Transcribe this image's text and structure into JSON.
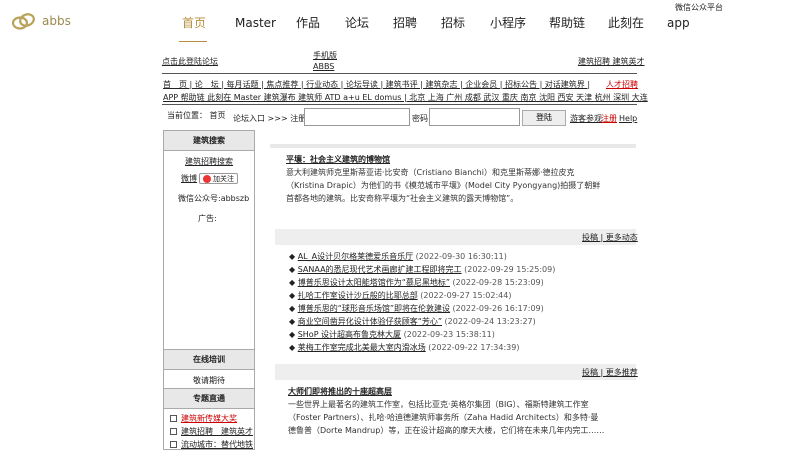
{
  "header": {
    "logo_text": "abbs",
    "wechat_platform": "微信公众平台",
    "nav": [
      {
        "label": "首页",
        "active": true
      },
      {
        "label": "Master"
      },
      {
        "label": "作品"
      },
      {
        "label": "论坛"
      },
      {
        "label": "招聘"
      },
      {
        "label": "招标"
      },
      {
        "label": "小程序"
      },
      {
        "label": "帮助链"
      },
      {
        "label": "此刻在"
      },
      {
        "label": "app"
      }
    ],
    "accent_color": "#b98d3e"
  },
  "subheader": {
    "login_hint": "点击此登陆论坛",
    "mobile_line1": "手机版",
    "mobile_line2": "ABBS",
    "jobs_link": "建筑招聘 建筑英才",
    "talent_link": "人才招聘",
    "links_row1": "首　页 | 论　坛 | 每月话题 | 焦点推荐 | 行业动态 | 论坛导读 | 建筑书评 | 建筑杂志 | 企业会员 | 招标公告 | 对话建筑界 |",
    "links_row2": "APP 帮助链 此刻在 Master 建筑瀑布 建筑师 ATD a+u EL domus | 北京 上海 广州 成都 武汉 重庆 南京 沈阳 西安 天津 杭州 深圳 大连"
  },
  "login": {
    "location": "当前位置：  首页",
    "entry": "论坛入口 >>> 注册名",
    "password_label": "密码",
    "username_value": "",
    "password_value": "",
    "login_button": "登陆",
    "guest": "游客参观",
    "register": "注册",
    "help": "Help"
  },
  "sidebar": {
    "search_head": "建筑搜索",
    "job_search": "建筑招聘搜索",
    "weibo": "微博",
    "follow": "加关注",
    "wechat_id": "微信公众号:abbszb",
    "ad": "广告:",
    "training_head": "在线培训",
    "coming_soon": "敬请期待",
    "special_head": "专题直通",
    "specials": [
      {
        "label": "建筑新传媒大奖",
        "highlight": true
      },
      {
        "label": "建筑招聘　建筑英才"
      },
      {
        "label": "流动城市：替代地铁"
      }
    ]
  },
  "main": {
    "feature": {
      "title": "平壤：社会主义建筑的博物馆",
      "body": "意大利建筑师克里斯蒂亚诺·比安奇（Cristiano Bianchi）和克里斯蒂娜·德拉皮克（Kristina Drapic）为他们的书《模范城市平壤》(Model City Pyongyang)拍摄了朝鲜首都各地的建筑。比安奇称平壤为“社会主义建筑的露天博物馆”。"
    },
    "news_links": "投稿 | 更多动态",
    "news": [
      {
        "title": "AL_A设计贝尔格莱德爱乐音乐厅",
        "date": "(2022-09-30 16:30:11)"
      },
      {
        "title": "SANAA的悉尼现代艺术画廊扩建工程即将完工",
        "date": "(2022-09-29 15:25:09)"
      },
      {
        "title": "博普乐思设计太阳能塔馆作为“慕尼黑地标”",
        "date": "(2022-09-28 15:23:09)"
      },
      {
        "title": "扎哈工作室设计沙丘般的比耶总部",
        "date": "(2022-09-27 15:02:44)"
      },
      {
        "title": "博普乐思的“球形音乐场馆”即将在伦敦建设",
        "date": "(2022-09-26 16:17:09)"
      },
      {
        "title": "商业空间凿异化设计体验仔获顾客“芳心”",
        "date": "(2022-09-24 13:23:27)"
      },
      {
        "title": "SHoP 设计超高布鲁克林大厦",
        "date": "(2022-09-23 15:38:11)"
      },
      {
        "title": "莱梅工作室完成北美最大室内滑冰场",
        "date": "(2022-09-22 17:34:39)"
      }
    ],
    "rec_links": "投稿 | 更多推荐",
    "rec": {
      "title": "大师们即将推出的十座超高层",
      "body": "一些世界上最著名的建筑工作室，包括比亚克·英格尔集团（BIG）、福斯特建筑工作室（Foster Partners）、扎哈·哈迪德建筑师事务所（Zaha Hadid Architects）和多特·曼德鲁普（Dorte Mandrup）等，正在设计超高的摩天大楼，它们将在未来几年内完工……"
    }
  }
}
